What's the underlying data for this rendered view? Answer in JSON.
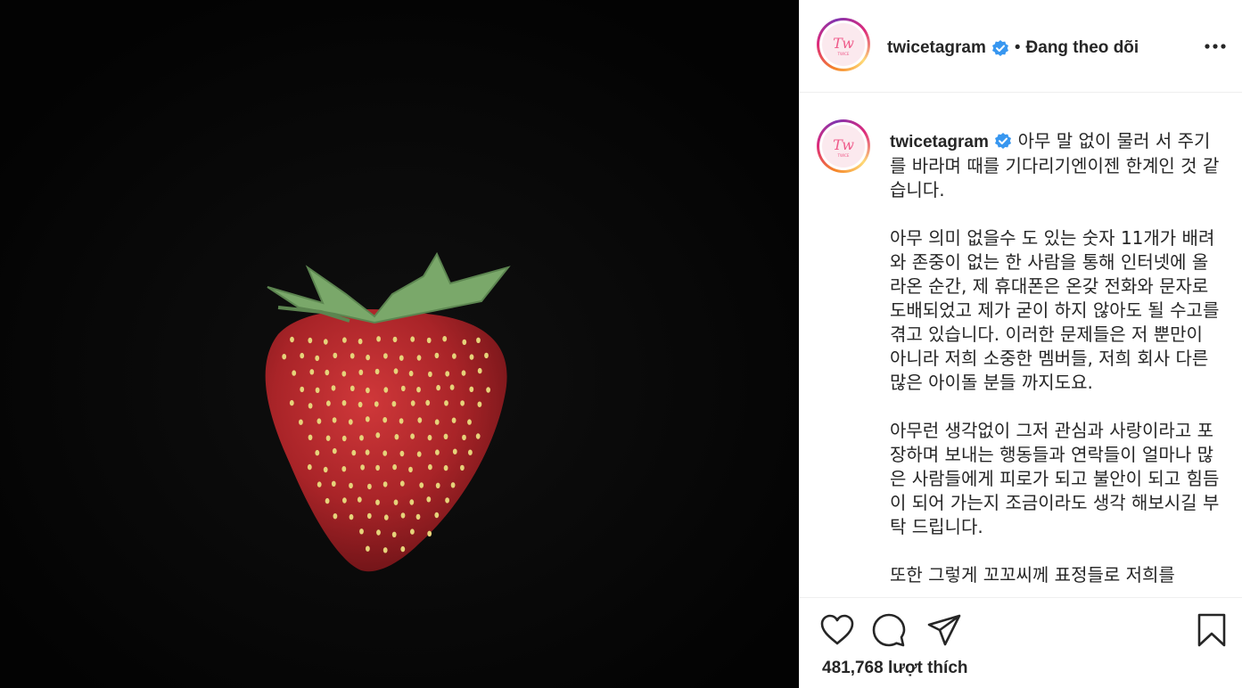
{
  "post": {
    "username": "twicetagram",
    "separator": "•",
    "follow_status": "Đang theo dõi",
    "avatar_logo_text": "TWICE",
    "caption_paragraphs": [
      "아무 말 없이 물러 서 주기를 바라며 때를 기다리기엔이젠 한계인 것 같습니다.",
      "아무 의미 없을수 도 있는 숫자 11개가 배려와 존중이 없는 한 사람을 통해 인터넷에 올라온 순간, 제 휴대폰은 온갖 전화와 문자로 도배되었고 제가 굳이 하지 않아도 될 수고를 겪고 있습니다. 이러한 문제들은 저 뿐만이 아니라 저희 소중한 멤버들, 저희 회사 다른 많은 아이돌 분들 까지도요.",
      "아무런 생각없이 그저 관심과 사랑이라고 포장하며 보내는 행동들과 연락들이 얼마나 많은 사람들에게 피로가 되고 불안이 되고 힘듬이 되어 가는지 조금이라도 생각 해보시길 부탁 드립니다.",
      "또한 그렇게 꼬꼬씨께 표정들로 저희를"
    ],
    "likes_text": "481,768 lượt thích"
  },
  "icons": {
    "verified": "verified-badge-icon",
    "more": "more-options-icon",
    "like": "heart-icon",
    "comment": "comment-icon",
    "share": "share-paper-plane-icon",
    "save": "bookmark-icon"
  },
  "colors": {
    "verified_blue": "#3897f0",
    "media_background": "#050505",
    "strawberry_red": "#b3282c",
    "leaf_green": "#7aa86a",
    "seed_yellow": "#e6d37a"
  }
}
